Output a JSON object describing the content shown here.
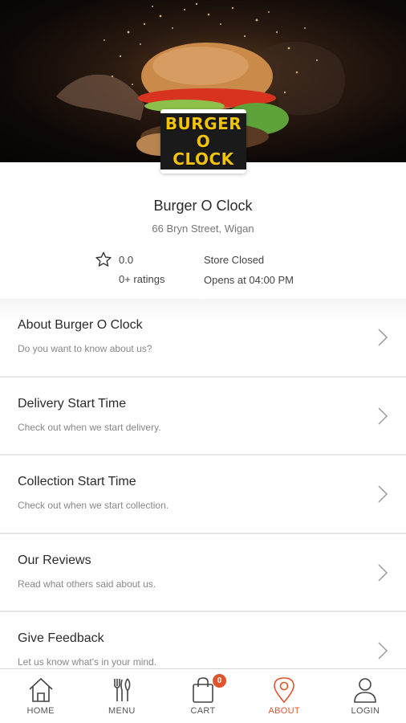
{
  "store": {
    "name": "Burger O Clock",
    "address": "66 Bryn Street, Wigan",
    "rating": "0.0",
    "ratings_count": "0+ ratings",
    "status": "Store Closed",
    "opens": "Opens at 04:00 PM",
    "logo_line1": "BURGER",
    "logo_line2": "O CLOCK"
  },
  "menu_items": [
    {
      "title": "About Burger O Clock",
      "subtitle": "Do you want to know about us?"
    },
    {
      "title": "Delivery Start Time",
      "subtitle": "Check out when we start delivery."
    },
    {
      "title": "Collection Start Time",
      "subtitle": "Check out when we start collection."
    },
    {
      "title": "Our Reviews",
      "subtitle": "Read what others said about us."
    },
    {
      "title": "Give Feedback",
      "subtitle": "Let us know what's in your mind."
    }
  ],
  "nav": {
    "home": "HOME",
    "menu": "MENU",
    "cart": "CART",
    "cart_count": "0",
    "about": "ABOUT",
    "login": "LOGIN"
  },
  "colors": {
    "accent": "#e2532c"
  },
  "icons": [
    "star-icon",
    "chevron-right-icon",
    "home-icon",
    "cutlery-icon",
    "shopping-bag-icon",
    "location-pin-icon",
    "user-icon"
  ]
}
